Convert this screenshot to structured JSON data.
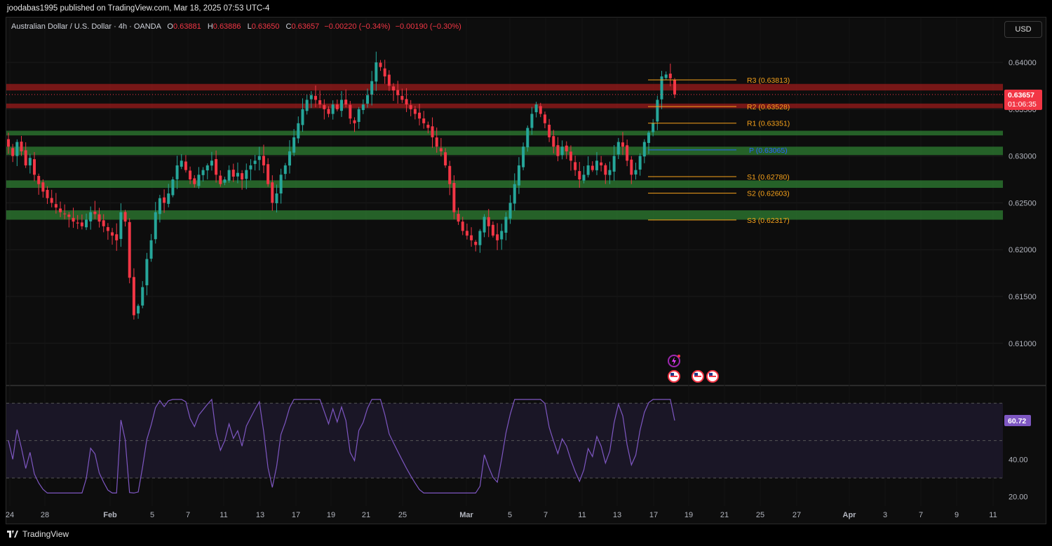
{
  "header": {
    "published": "joodabas1995 published on TradingView.com, Mar 18, 2025 07:53 UTC-4"
  },
  "legend": {
    "symbol": "Australian Dollar / U.S. Dollar · 4h · OANDA",
    "o_label": "O",
    "o": "0.63881",
    "h_label": "H",
    "h": "0.63886",
    "l_label": "L",
    "l": "0.63650",
    "c_label": "C",
    "c": "0.63657",
    "change": "−0.00220 (−0.34%)",
    "change2": "−0.00190 (−0.30%)"
  },
  "currency_button": "USD",
  "price_badge": {
    "price": "0.63657",
    "countdown": "01:06:35"
  },
  "rsi_badge": "60.72",
  "footer": {
    "logo_text": "TradingView"
  },
  "colors": {
    "up": "#26a69a",
    "down": "#f23645",
    "pivot_line": "#f7a21b",
    "pivot_p": "#2962ff",
    "support_zone": "#2e7d32",
    "resistance_zone": "#8b1a1a",
    "rsi": "#7e57c2"
  },
  "chart_data": [
    {
      "type": "candlestick",
      "interval": "4h",
      "ylim": [
        0.605,
        0.642
      ],
      "y_ticks": [
        "0.64000",
        "0.63500",
        "0.63000",
        "0.62500",
        "0.62000",
        "0.61500",
        "0.61000"
      ],
      "x_ticks": [
        "24",
        "28",
        "Feb",
        "5",
        "7",
        "11",
        "13",
        "17",
        "19",
        "21",
        "25",
        "Mar",
        "5",
        "7",
        "11",
        "13",
        "17",
        "19",
        "21",
        "25",
        "27",
        "Apr",
        "3",
        "7",
        "9",
        "11"
      ],
      "pivots": [
        {
          "label": "R3 (0.63813)",
          "value": 0.63813
        },
        {
          "label": "R2 (0.63528)",
          "value": 0.63528
        },
        {
          "label": "R1 (0.63351)",
          "value": 0.63351
        },
        {
          "label": "P (0.63065)",
          "value": 0.63065
        },
        {
          "label": "S1 (0.62780)",
          "value": 0.6278
        },
        {
          "label": "S2 (0.62603)",
          "value": 0.62603
        },
        {
          "label": "S3 (0.62317)",
          "value": 0.62317
        }
      ],
      "resistance_zones": [
        [
          0.637,
          0.6377
        ],
        [
          0.6351,
          0.6356
        ]
      ],
      "support_zones": [
        [
          0.6322,
          0.6327
        ],
        [
          0.6301,
          0.631
        ],
        [
          0.6266,
          0.6274
        ],
        [
          0.6232,
          0.6242
        ]
      ],
      "last_close": 0.63657,
      "closes": [
        0.631,
        0.63,
        0.6315,
        0.6305,
        0.629,
        0.6298,
        0.628,
        0.627,
        0.6262,
        0.6255,
        0.625,
        0.6245,
        0.624,
        0.6238,
        0.6235,
        0.623,
        0.6228,
        0.6225,
        0.6232,
        0.624,
        0.6238,
        0.623,
        0.6225,
        0.622,
        0.6215,
        0.621,
        0.624,
        0.623,
        0.617,
        0.613,
        0.614,
        0.616,
        0.619,
        0.621,
        0.624,
        0.6255,
        0.625,
        0.626,
        0.6275,
        0.629,
        0.6295,
        0.6285,
        0.6275,
        0.627,
        0.628,
        0.6285,
        0.629,
        0.6295,
        0.628,
        0.627,
        0.6275,
        0.6285,
        0.6278,
        0.6282,
        0.6275,
        0.6285,
        0.629,
        0.6295,
        0.63,
        0.629,
        0.627,
        0.625,
        0.626,
        0.628,
        0.629,
        0.6305,
        0.632,
        0.6335,
        0.635,
        0.636,
        0.6365,
        0.636,
        0.6355,
        0.635,
        0.6345,
        0.6355,
        0.635,
        0.636,
        0.6355,
        0.634,
        0.6335,
        0.635,
        0.6355,
        0.6365,
        0.638,
        0.64,
        0.6395,
        0.6385,
        0.6375,
        0.637,
        0.6365,
        0.636,
        0.6355,
        0.635,
        0.6345,
        0.634,
        0.6335,
        0.633,
        0.632,
        0.631,
        0.6305,
        0.629,
        0.627,
        0.624,
        0.623,
        0.622,
        0.6215,
        0.621,
        0.6205,
        0.622,
        0.6235,
        0.6225,
        0.6215,
        0.621,
        0.622,
        0.6235,
        0.625,
        0.627,
        0.629,
        0.631,
        0.633,
        0.6345,
        0.6355,
        0.6345,
        0.6335,
        0.632,
        0.631,
        0.63,
        0.631,
        0.6305,
        0.6295,
        0.6285,
        0.6275,
        0.628,
        0.629,
        0.6285,
        0.6295,
        0.629,
        0.628,
        0.6285,
        0.63,
        0.6315,
        0.631,
        0.6295,
        0.628,
        0.6285,
        0.63,
        0.6315,
        0.6325,
        0.6335,
        0.636,
        0.6385,
        0.6387,
        0.6383,
        0.63657
      ]
    },
    {
      "type": "line",
      "name": "RSI",
      "ylim": [
        15,
        80
      ],
      "y_ticks": [
        "40.00",
        "20.00"
      ],
      "bands": [
        70,
        50,
        30
      ],
      "last_value": 60.72
    }
  ]
}
